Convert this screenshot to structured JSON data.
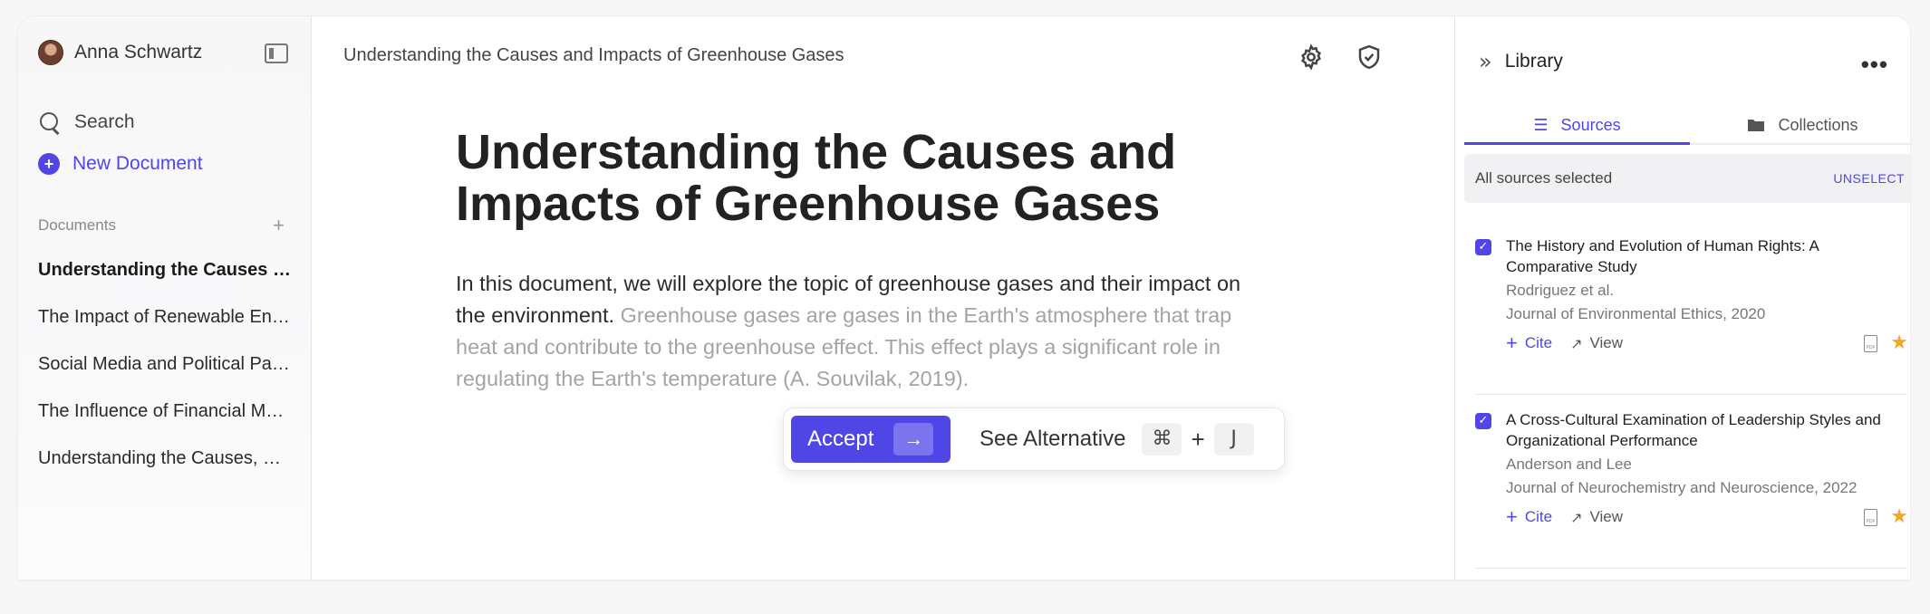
{
  "sidebar": {
    "user_name": "Anna Schwartz",
    "search_label": "Search",
    "new_document_label": "New Document",
    "documents_title": "Documents",
    "documents_add": "+",
    "documents": [
      {
        "label": "Understanding the Causes and Impacts of Greenhouse Gases"
      },
      {
        "label": "The Impact of Renewable Energy"
      },
      {
        "label": "Social Media and Political Participation"
      },
      {
        "label": "The Influence of Financial Markets"
      },
      {
        "label": "Understanding the Causes, Effects and Solutions"
      }
    ]
  },
  "main": {
    "topbar_title": "Understanding the Causes and Impacts of Greenhouse Gases",
    "heading": "Understanding the Causes and Impacts of Greenhouse Gases",
    "body_text": "In this document, we will explore the topic of greenhouse gases and their impact on the environment. ",
    "suggestion_text": "Greenhouse gases are gases in the Earth's atmosphere that trap heat and contribute to the greenhouse effect. This effect plays a significant role in regulating the Earth's temperature (A. Souvilak, 2019).",
    "ai_bar": {
      "accept_label": "Accept",
      "accept_arrow": "→",
      "see_alternative_label": "See Alternative",
      "key_cmd": "⌘",
      "key_plus": "+",
      "key_j": "J"
    }
  },
  "library": {
    "title": "Library",
    "collapse_icon": "»",
    "more_icon": "•••",
    "tabs": [
      {
        "label": "Sources",
        "icon": "list-icon",
        "active": true
      },
      {
        "label": "Collections",
        "icon": "folder-icon",
        "active": false
      }
    ],
    "selection_text": "All sources selected",
    "unselect_label": "UNSELECT",
    "sources": [
      {
        "title": "The History and Evolution of Human Rights: A Comparative Study",
        "authors": "Rodriguez et al.",
        "journal": "Journal of Environmental Ethics, 2020",
        "cite_label": "Cite",
        "view_label": "View",
        "file_badge": "PDF"
      },
      {
        "title": "A Cross-Cultural Examination of Leadership Styles and Organizational Performance",
        "authors": "Anderson and Lee",
        "journal": "Journal of Neurochemistry and Neuroscience, 2022",
        "cite_label": "Cite",
        "view_label": "View",
        "file_badge": "PDF"
      }
    ]
  },
  "colors": {
    "accent": "#4f46e5",
    "suggestion_text": "#a3a3a8",
    "star": "#f5a623"
  }
}
